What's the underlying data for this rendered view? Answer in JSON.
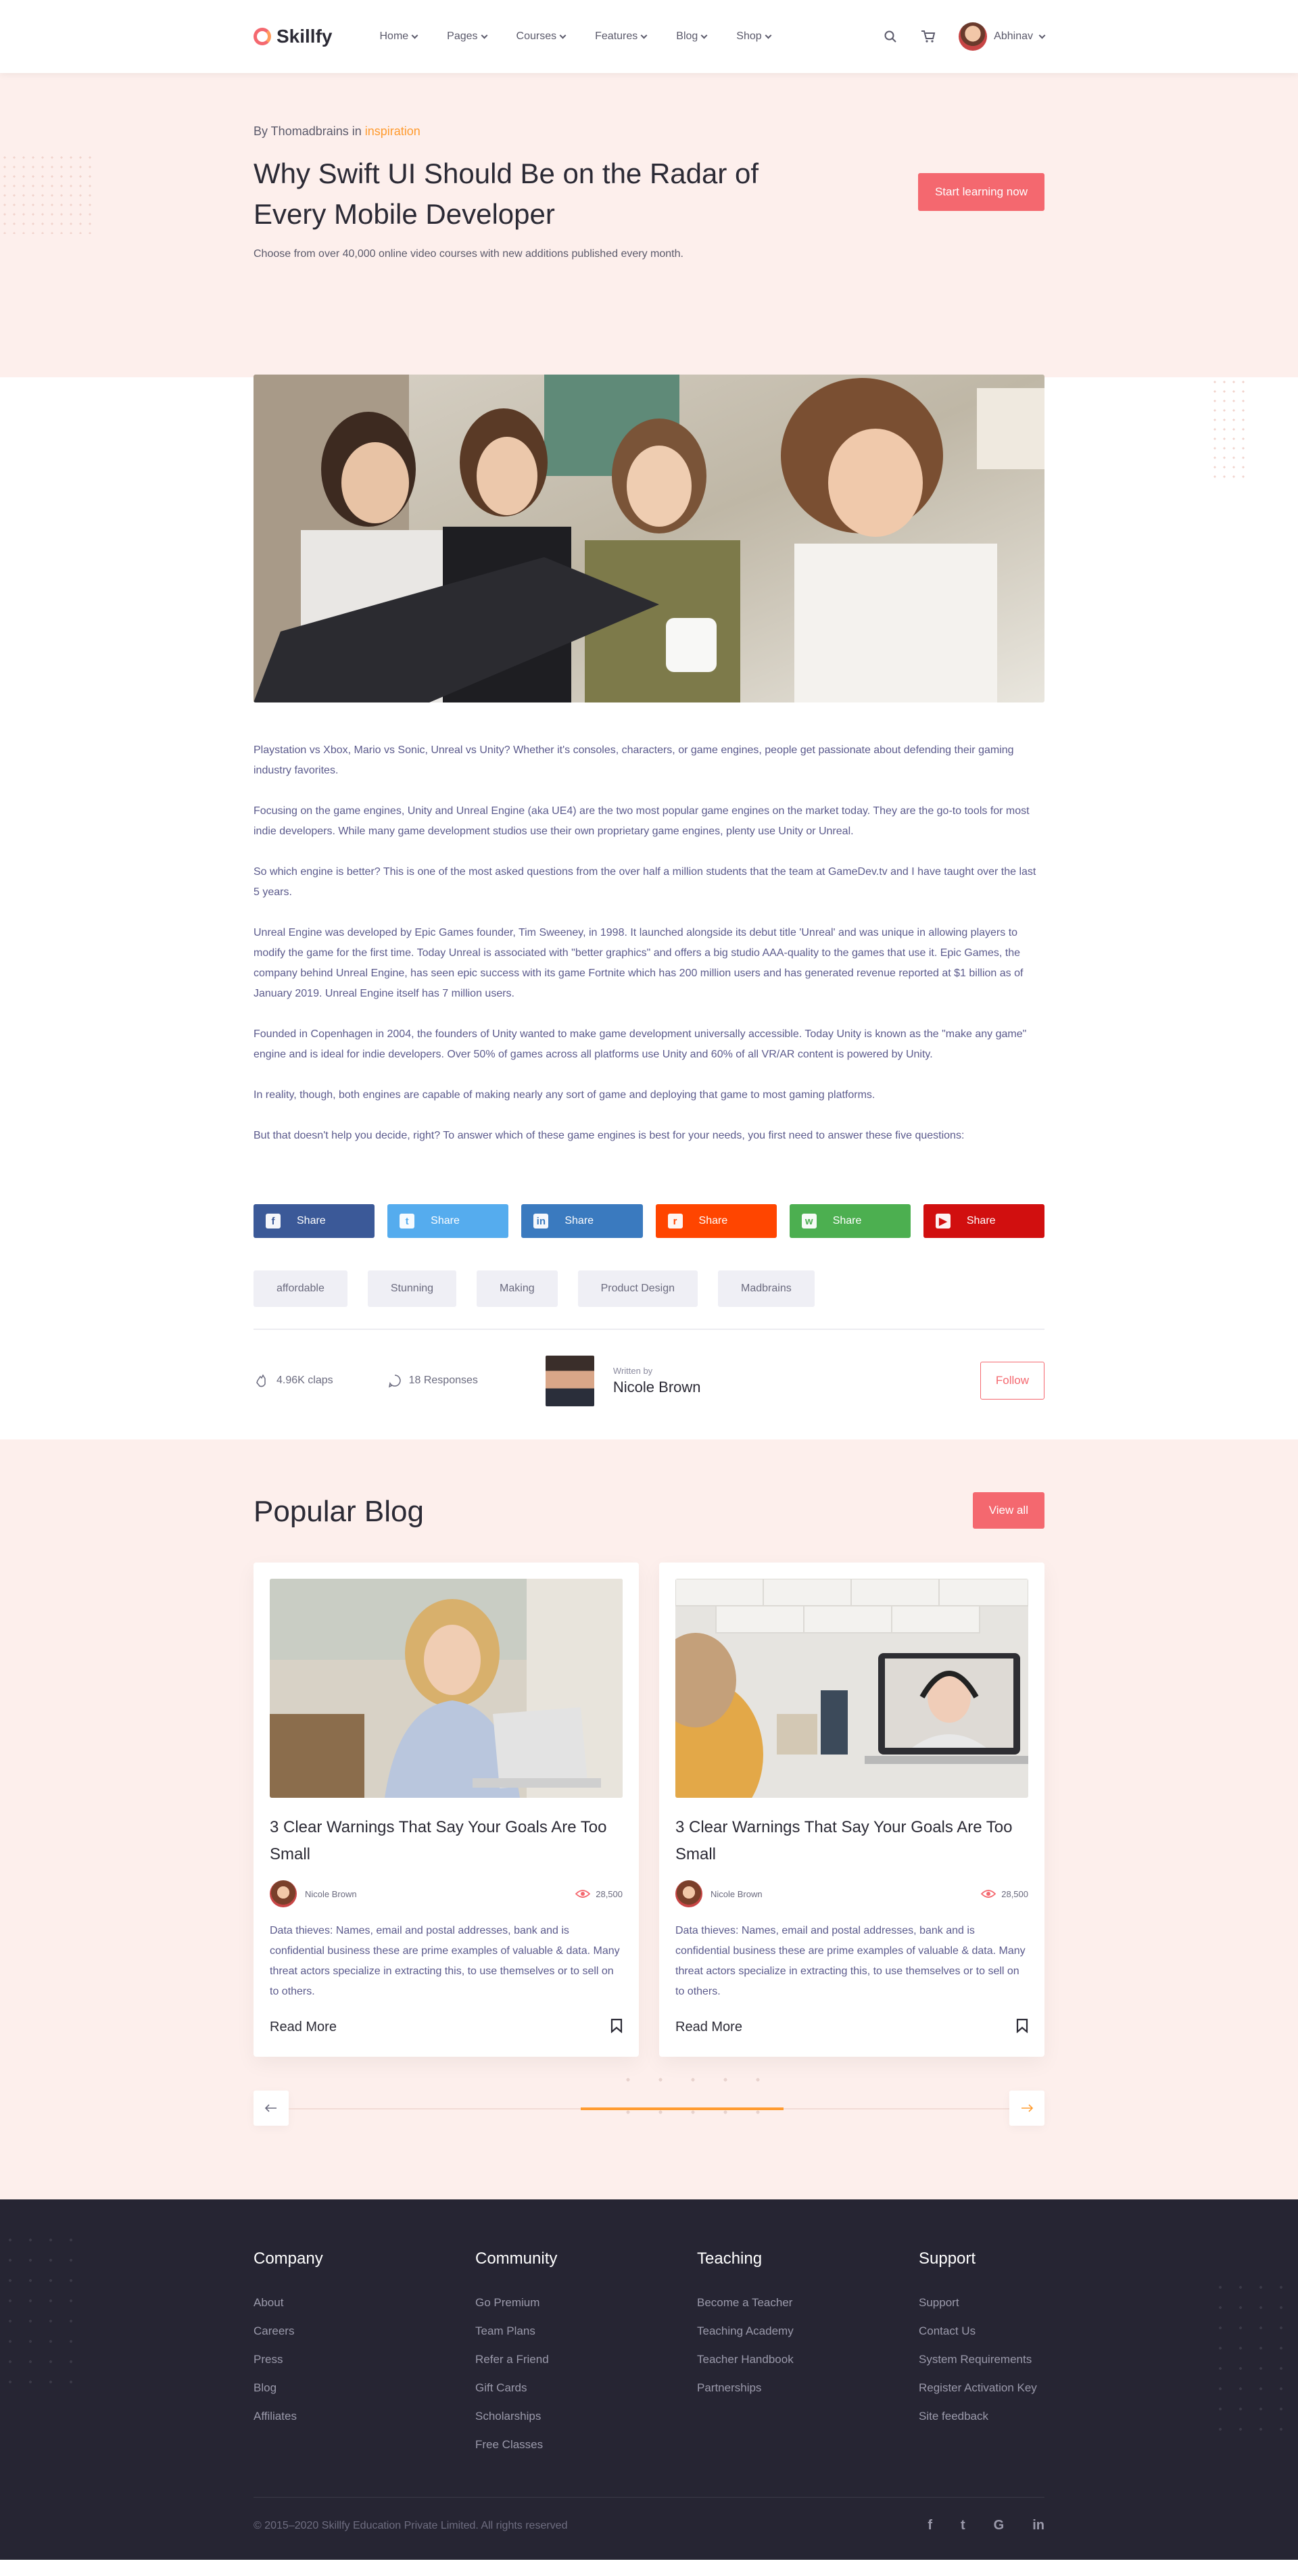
{
  "header": {
    "brand": "Skillfy",
    "nav": [
      "Home",
      "Pages",
      "Courses",
      "Features",
      "Blog",
      "Shop"
    ],
    "user_name": "Abhinav"
  },
  "hero": {
    "by_prefix": "By Thomadbrains in",
    "category": "inspiration",
    "title": "Why Swift UI Should Be on the Radar of Every Mobile Developer",
    "subtitle": "Choose from over 40,000 online video courses with new additions published every month.",
    "cta": "Start learning now"
  },
  "article": {
    "paragraphs": [
      "Playstation vs Xbox, Mario vs Sonic, Unreal vs Unity? Whether it's consoles, characters, or game engines, people get passionate about defending their gaming industry favorites.",
      "Focusing on the game engines, Unity and Unreal Engine (aka UE4) are the two most popular game engines on the market today. They are the go-to tools for most indie developers. While many game development studios use their own proprietary game engines, plenty use Unity or Unreal.",
      "So which engine is better? This is one of the most asked questions from the over half a million students that the team at GameDev.tv and I have taught over the last 5 years.",
      "Unreal Engine was developed by Epic Games founder, Tim Sweeney, in 1998. It launched alongside its debut title 'Unreal' and was unique in allowing players to modify the game for the first time. Today Unreal is associated with \"better graphics\" and offers a big studio AAA-quality to the games that use it. Epic Games, the company behind Unreal Engine, has seen epic success with its game Fortnite which has 200 million users and has generated revenue reported at $1 billion as of January 2019. Unreal Engine itself has 7 million users.",
      "Founded in Copenhagen in 2004, the founders of Unity wanted to make game development universally accessible. Today Unity is known as the \"make any game\" engine and is ideal for indie developers. Over 50% of games across all platforms use Unity and 60% of all VR/AR content is powered by Unity.",
      "In reality, though, both engines are capable of making nearly any sort of game and deploying that game to most gaming platforms.",
      "But that doesn't help you decide, right? To answer which of these game engines is best for your needs, you first need to answer these five questions:"
    ],
    "share_label": "Share",
    "share": [
      {
        "network": "facebook",
        "icon": "f",
        "color": "#3b5998"
      },
      {
        "network": "twitter",
        "icon": "t",
        "color": "#55acee"
      },
      {
        "network": "linkedin",
        "icon": "in",
        "color": "#3a7abf"
      },
      {
        "network": "reddit",
        "icon": "r",
        "color": "#ff4500"
      },
      {
        "network": "whatsapp",
        "icon": "w",
        "color": "#4caf50"
      },
      {
        "network": "youtube",
        "icon": "▶",
        "color": "#d10f0f"
      }
    ],
    "tags": [
      "affordable",
      "Stunning",
      "Making",
      "Product Design",
      "Madbrains"
    ],
    "claps": "4.96K claps",
    "responses": "18 Responses",
    "written_by": "Written by",
    "author": "Nicole Brown",
    "follow": "Follow"
  },
  "popular": {
    "title": "Popular Blog",
    "view_all": "View all",
    "cards": [
      {
        "title": "3 Clear Warnings That Say Your Goals Are Too Small",
        "author": "Nicole Brown",
        "views": "28,500",
        "desc": "Data thieves: Names, email and postal addresses, bank and is confidential business these are prime examples of valuable & data. Many threat actors specialize in extracting this, to use themselves or to sell on to others.",
        "read_more": "Read More"
      },
      {
        "title": "3 Clear Warnings That Say Your Goals Are Too Small",
        "author": "Nicole Brown",
        "views": "28,500",
        "desc": "Data thieves: Names, email and postal addresses, bank and is confidential business these are prime examples of valuable & data. Many threat actors specialize in extracting this, to use themselves or to sell on to others.",
        "read_more": "Read More"
      }
    ]
  },
  "footer": {
    "columns": [
      {
        "title": "Company",
        "links": [
          "About",
          "Careers",
          "Press",
          "Blog",
          "Affiliates"
        ]
      },
      {
        "title": "Community",
        "links": [
          "Go Premium",
          "Team Plans",
          "Refer a Friend",
          "Gift Cards",
          "Scholarships",
          "Free Classes"
        ]
      },
      {
        "title": "Teaching",
        "links": [
          "Become a Teacher",
          "Teaching Academy",
          "Teacher Handbook",
          "Partnerships"
        ]
      },
      {
        "title": "Support",
        "links": [
          "Support",
          "Contact Us",
          "System Requirements",
          "Register Activation Key",
          "Site feedback"
        ]
      }
    ],
    "copyright": "© 2015–2020 Skillfy Education Private Limited. All rights reserved",
    "socials": [
      {
        "name": "facebook",
        "glyph": "f"
      },
      {
        "name": "twitter",
        "glyph": "t"
      },
      {
        "name": "google",
        "glyph": "G"
      },
      {
        "name": "linkedin",
        "glyph": "in"
      }
    ]
  },
  "colors": {
    "accent": "#f4686f",
    "orange": "#ff9b2f",
    "hero_bg": "#fdefec",
    "footer_bg": "#262533"
  }
}
